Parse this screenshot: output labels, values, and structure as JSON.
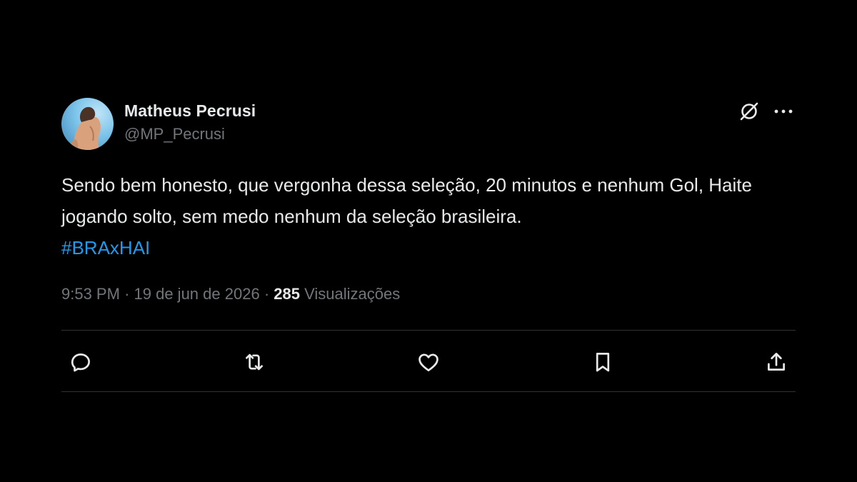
{
  "tweet": {
    "author": {
      "display_name": "Matheus Pecrusi",
      "handle": "@MP_Pecrusi"
    },
    "text_main": "Sendo bem honesto, que vergonha dessa seleção, 20 minutos e nenhum Gol, Haite jogando solto, sem medo nenhum da seleção brasileira.",
    "hashtag": "#BRAxHAI",
    "time": "9:53 PM",
    "separator": "·",
    "date": "19 de jun de 2026",
    "views_count": "285",
    "views_label": "Visualizações"
  },
  "colors": {
    "background": "#000000",
    "text_primary": "#e7e9ea",
    "text_secondary": "#71767b",
    "link": "#1d9bf0",
    "divider": "#2f3336"
  },
  "icons": {
    "header": [
      "grok-icon",
      "more-icon"
    ],
    "actions": [
      "reply-icon",
      "retweet-icon",
      "like-icon",
      "bookmark-icon",
      "share-icon"
    ]
  }
}
